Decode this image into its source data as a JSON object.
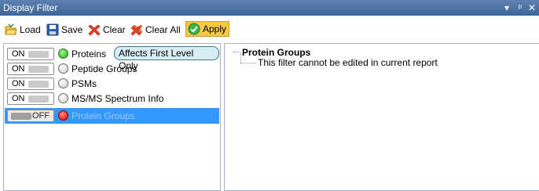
{
  "window": {
    "title": "Display Filter",
    "controls": {
      "dropdown": "▾",
      "pin": "p",
      "close": "✕"
    }
  },
  "toolbar": {
    "load_label": "Load",
    "save_label": "Save",
    "clear_label": "Clear",
    "clear_all_label": "Clear All",
    "apply_label": "Apply"
  },
  "filters": [
    {
      "toggle": "ON",
      "status": "green",
      "label": "Proteins",
      "badge": "Affects First Level Only"
    },
    {
      "toggle": "ON",
      "status": "grey",
      "label": "Peptide Groups"
    },
    {
      "toggle": "ON",
      "status": "grey",
      "label": "PSMs"
    },
    {
      "toggle": "ON",
      "status": "grey",
      "label": "MS/MS Spectrum Info"
    },
    {
      "toggle": "OFF",
      "status": "red",
      "label": "Protein Groups",
      "selected": true
    }
  ],
  "detail": {
    "root": "Protein Groups",
    "child": "This filter cannot be edited in current report"
  },
  "colors": {
    "titlebar": "#4a71a4",
    "selection": "#3399ff",
    "apply_bg": "#f6c84a"
  }
}
